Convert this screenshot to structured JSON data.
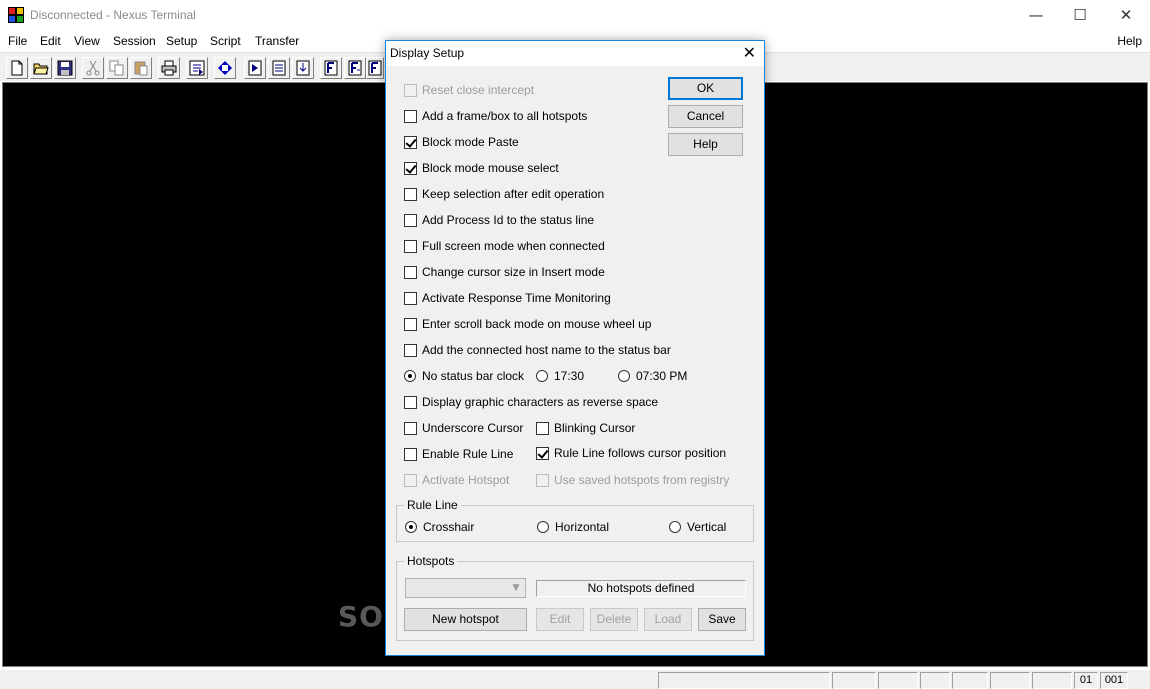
{
  "window": {
    "title": "Disconnected - Nexus Terminal",
    "minimize_glyph": "—",
    "maximize_glyph": "☐",
    "close_glyph": "✕"
  },
  "menu": {
    "file": "File",
    "edit": "Edit",
    "view": "View",
    "session": "Session",
    "setup": "Setup",
    "script": "Script",
    "transfer": "Transfer",
    "help": "Help"
  },
  "toolbar": {
    "icons": [
      "new-file-icon",
      "open-folder-icon",
      "save-icon",
      "cut-icon",
      "copy-icon",
      "paste-icon",
      "print-icon",
      "session-icon",
      "connect-icon",
      "script-run-icon",
      "script-step-icon",
      "transfer-down-icon",
      "field-1-icon",
      "field-2-icon",
      "field-3-icon"
    ]
  },
  "status": {
    "line": "01",
    "column": "001"
  },
  "watermark": "SOFTPEDIA",
  "dialog": {
    "title": "Display Setup",
    "close_glyph": "✕",
    "buttons": {
      "ok": "OK",
      "cancel": "Cancel",
      "help": "Help"
    },
    "options": {
      "reset_close": {
        "label": "Reset close intercept",
        "checked": false,
        "disabled": true
      },
      "frame_hotspots": {
        "label": "Add a frame/box to all hotspots",
        "checked": false
      },
      "block_paste": {
        "label": "Block mode Paste",
        "checked": true
      },
      "block_select": {
        "label": "Block mode mouse select",
        "checked": true
      },
      "keep_selection": {
        "label": "Keep selection after edit operation",
        "checked": false
      },
      "process_id": {
        "label": "Add Process Id to the status line",
        "checked": false
      },
      "full_screen": {
        "label": "Full screen mode when connected",
        "checked": false
      },
      "cursor_size": {
        "label": "Change cursor size in Insert mode",
        "checked": false
      },
      "response_time": {
        "label": "Activate Response Time Monitoring",
        "checked": false
      },
      "scroll_back": {
        "label": "Enter scroll back mode on mouse wheel up",
        "checked": false
      },
      "host_name": {
        "label": "Add the connected host name to the status bar",
        "checked": false
      },
      "reverse_space": {
        "label": "Display graphic characters as reverse space",
        "checked": false
      },
      "underscore_cursor": {
        "label": "Underscore Cursor",
        "checked": false
      },
      "blinking_cursor": {
        "label": "Blinking Cursor",
        "checked": false
      },
      "enable_rule_line": {
        "label": "Enable Rule Line",
        "checked": false
      },
      "rule_follows": {
        "label": "Rule Line follows cursor position",
        "checked": true
      },
      "activate_hotspot": {
        "label": "Activate Hotspot",
        "checked": false,
        "disabled": true
      },
      "saved_hotspots": {
        "label": "Use saved hotspots from registry",
        "checked": false,
        "disabled": true
      }
    },
    "clock": {
      "none": "No status bar clock",
      "h24": "17:30",
      "h12": "07:30 PM",
      "selected": "none"
    },
    "rule_line": {
      "group_label": "Rule Line",
      "crosshair": "Crosshair",
      "horizontal": "Horizontal",
      "vertical": "Vertical",
      "selected": "crosshair"
    },
    "hotspots": {
      "group_label": "Hotspots",
      "combo_value": "",
      "status": "No hotspots defined",
      "new": "New hotspot",
      "edit": "Edit",
      "delete": "Delete",
      "load": "Load",
      "save": "Save"
    }
  }
}
